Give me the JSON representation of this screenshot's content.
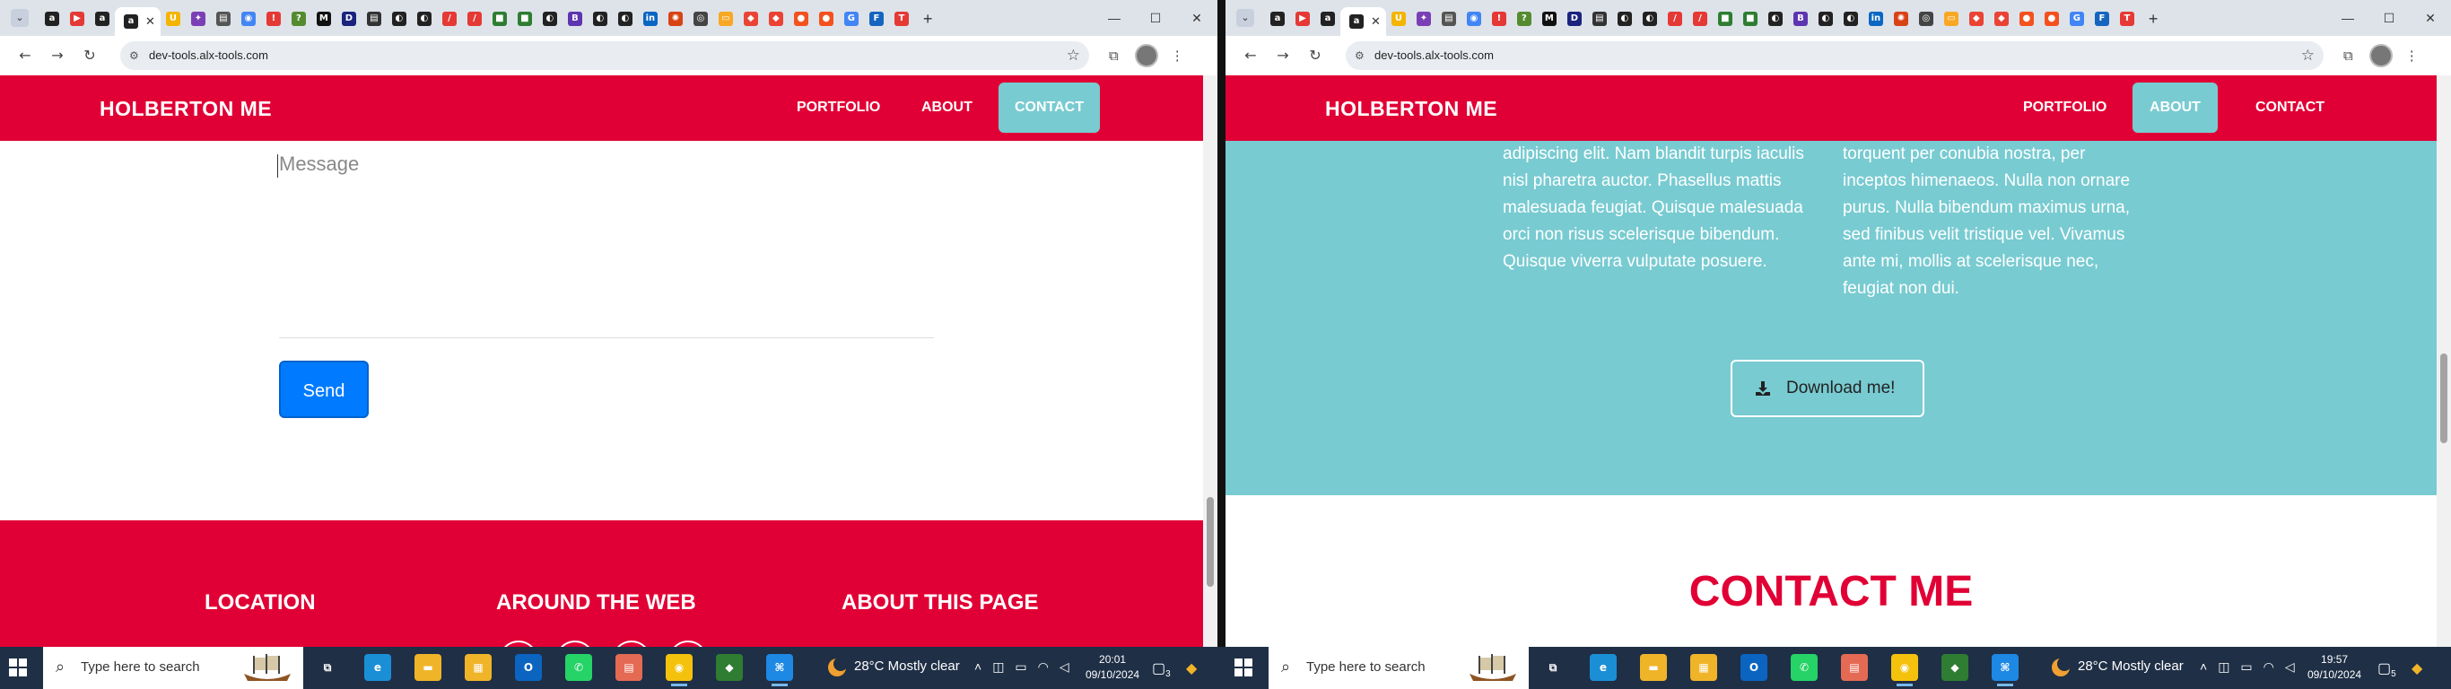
{
  "colors": {
    "brand_red": "#e10035",
    "teal": "#78cbd1",
    "send_blue": "#007bff"
  },
  "tab_icons": [
    {
      "icon": "alx-icon",
      "glyph": "a",
      "color": "#222"
    },
    {
      "icon": "youtube-icon",
      "glyph": "▶",
      "color": "#e53935"
    },
    {
      "icon": "alx-icon",
      "glyph": "a",
      "color": "#222"
    },
    {
      "icon": "udemy-icon",
      "glyph": "U",
      "color": "#f4b400"
    },
    {
      "icon": "bookmark-icon",
      "glyph": "✦",
      "color": "#7b3fb5"
    },
    {
      "icon": "book-icon",
      "glyph": "▤",
      "color": "#555"
    },
    {
      "icon": "chrome-icon",
      "glyph": "◉",
      "color": "#4285f4"
    },
    {
      "icon": "pin-icon",
      "glyph": "!",
      "color": "#e53935"
    },
    {
      "icon": "help-icon",
      "glyph": "?",
      "color": "#558b2f"
    },
    {
      "icon": "medium-icon",
      "glyph": "M",
      "color": "#111"
    },
    {
      "icon": "dev-icon",
      "glyph": "D",
      "color": "#1a237e"
    },
    {
      "icon": "book-icon",
      "glyph": "▤",
      "color": "#333"
    },
    {
      "icon": "github-icon",
      "glyph": "◐",
      "color": "#222"
    },
    {
      "icon": "github-icon",
      "glyph": "◐",
      "color": "#222"
    },
    {
      "icon": "slash-icon",
      "glyph": "/",
      "color": "#e53935"
    },
    {
      "icon": "slash-icon",
      "glyph": "/",
      "color": "#e53935"
    },
    {
      "icon": "cube-icon",
      "glyph": "■",
      "color": "#2e7d32"
    },
    {
      "icon": "cube-icon",
      "glyph": "■",
      "color": "#2e7d32"
    },
    {
      "icon": "github-icon",
      "glyph": "◐",
      "color": "#222"
    },
    {
      "icon": "bold-icon",
      "glyph": "B",
      "color": "#5e35b1"
    },
    {
      "icon": "github-icon",
      "glyph": "◐",
      "color": "#222"
    },
    {
      "icon": "github-icon",
      "glyph": "◐",
      "color": "#222"
    },
    {
      "icon": "linkedin-icon",
      "glyph": "in",
      "color": "#0a66c2"
    },
    {
      "icon": "spark-icon",
      "glyph": "✺",
      "color": "#d84315"
    },
    {
      "icon": "circle-icon",
      "glyph": "◎",
      "color": "#444"
    },
    {
      "icon": "folder-icon",
      "glyph": "▭",
      "color": "#f9a825"
    },
    {
      "icon": "maps-icon",
      "glyph": "◆",
      "color": "#ea4335"
    },
    {
      "icon": "maps-icon",
      "glyph": "◆",
      "color": "#ea4335"
    },
    {
      "icon": "orange-icon",
      "glyph": "●",
      "color": "#f4511e"
    },
    {
      "icon": "orange-icon",
      "glyph": "●",
      "color": "#f4511e"
    },
    {
      "icon": "google-icon",
      "glyph": "G",
      "color": "#4285f4"
    },
    {
      "icon": "forms-icon",
      "glyph": "F",
      "color": "#1565c0"
    },
    {
      "icon": "text-icon",
      "glyph": "T",
      "color": "#e53935"
    }
  ],
  "left": {
    "url": "dev-tools.alx-tools.com",
    "brand": "HOLBERTON ME",
    "nav": [
      {
        "label": "PORTFOLIO",
        "active": false
      },
      {
        "label": "ABOUT",
        "active": false
      },
      {
        "label": "CONTACT",
        "active": true
      }
    ],
    "message_placeholder": "Message",
    "send_label": "Send",
    "footer_headings": [
      "LOCATION",
      "AROUND THE WEB",
      "ABOUT THIS PAGE"
    ],
    "scroll_position": 0.8
  },
  "right": {
    "url": "dev-tools.alx-tools.com",
    "brand": "HOLBERTON ME",
    "nav": [
      {
        "label": "PORTFOLIO",
        "active": false
      },
      {
        "label": "ABOUT",
        "active": true
      },
      {
        "label": "CONTACT",
        "active": false
      }
    ],
    "about_col1": [
      "adipiscing elit. Nam blandit turpis iaculis",
      "nisl pharetra auctor. Phasellus mattis",
      "malesuada feugiat. Quisque malesuada",
      "orci non risus scelerisque bibendum.",
      "Quisque viverra vulputate posuere."
    ],
    "about_col2": [
      "torquent per conubia nostra, per",
      "inceptos himenaeos. Nulla non ornare",
      "purus. Nulla bibendum maximus urna,",
      "sed finibus velit tristique vel. Vivamus",
      "ante mi, mollis at scelerisque nec,",
      "feugiat non dui."
    ],
    "download_label": "Download me!",
    "contact_heading": "CONTACT ME",
    "scroll_position": 0.55
  },
  "taskbar_left": {
    "search_placeholder": "Type here to search",
    "weather": "28°C  Mostly clear",
    "time": "20:01",
    "date": "09/10/2024",
    "notifications": "3"
  },
  "taskbar_right": {
    "search_placeholder": "Type here to search",
    "weather": "28°C  Mostly clear",
    "time": "19:57",
    "date": "09/10/2024",
    "notifications": "5"
  },
  "taskbar_apps": [
    {
      "icon": "task-view-icon",
      "glyph": "⧉",
      "color": "transparent",
      "running": false
    },
    {
      "icon": "edge-icon",
      "glyph": "e",
      "color": "#1b8fd6",
      "running": false
    },
    {
      "icon": "file-explorer-icon",
      "glyph": "▬",
      "color": "#f0b429",
      "running": false
    },
    {
      "icon": "store-icon",
      "glyph": "▦",
      "color": "#f0b429",
      "running": false
    },
    {
      "icon": "outlook-icon",
      "glyph": "O",
      "color": "#0b64c0",
      "running": false
    },
    {
      "icon": "whatsapp-icon",
      "glyph": "✆",
      "color": "#25d366",
      "running": false
    },
    {
      "icon": "document-icon",
      "glyph": "▤",
      "color": "#e56a54",
      "running": false
    },
    {
      "icon": "chrome-icon",
      "glyph": "◉",
      "color": "#f4c20d",
      "running": true
    },
    {
      "icon": "game-icon",
      "glyph": "◆",
      "color": "#2e7d32",
      "running": false
    },
    {
      "icon": "vscode-icon",
      "glyph": "⌘",
      "color": "#1e88e5",
      "running": true
    }
  ]
}
